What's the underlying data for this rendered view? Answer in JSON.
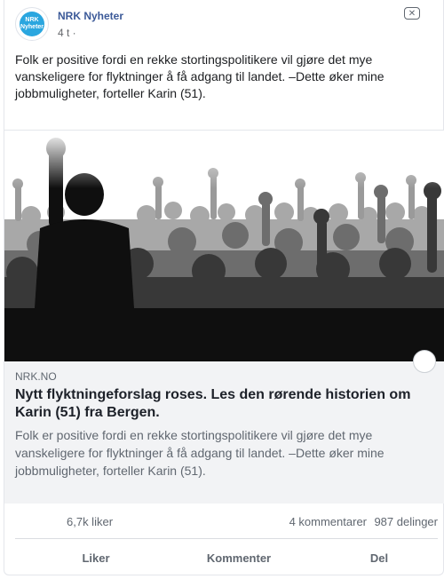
{
  "post": {
    "page_name": "NRK Nyheter",
    "avatar_label": "NRK Nyheter",
    "time": "4 t ·",
    "text": "Folk er positive fordi en rekke stortingspolitikere vil gjøre det mye vanskeligere for flyktninger å få adgang til landet. –Dette øker mine jobbmuligheter, forteller Karin (51)."
  },
  "link": {
    "domain": "NRK.NO",
    "title": "Nytt flyktningeforslag roses. Les den rørende historien om Karin (51) fra Bergen.",
    "description": "Folk er positive fordi en rekke stortingspolitikere vil gjøre det mye vanskeligere for flyktninger å få adgang til landet. –Dette øker mine jobbmuligheter, forteller Karin (51)."
  },
  "stats": {
    "likes": "6,7k liker",
    "comments": "4 kommentarer",
    "shares": "987 delinger"
  },
  "actions": {
    "like": "Liker",
    "comment": "Kommenter",
    "share": "Del"
  },
  "icons": {
    "close": "close-icon",
    "avatar": "nrk-logo-icon"
  },
  "colors": {
    "page_name": "#3b5998",
    "avatar_bg": "#2aa6df",
    "link_preview_bg": "#f2f3f5"
  }
}
